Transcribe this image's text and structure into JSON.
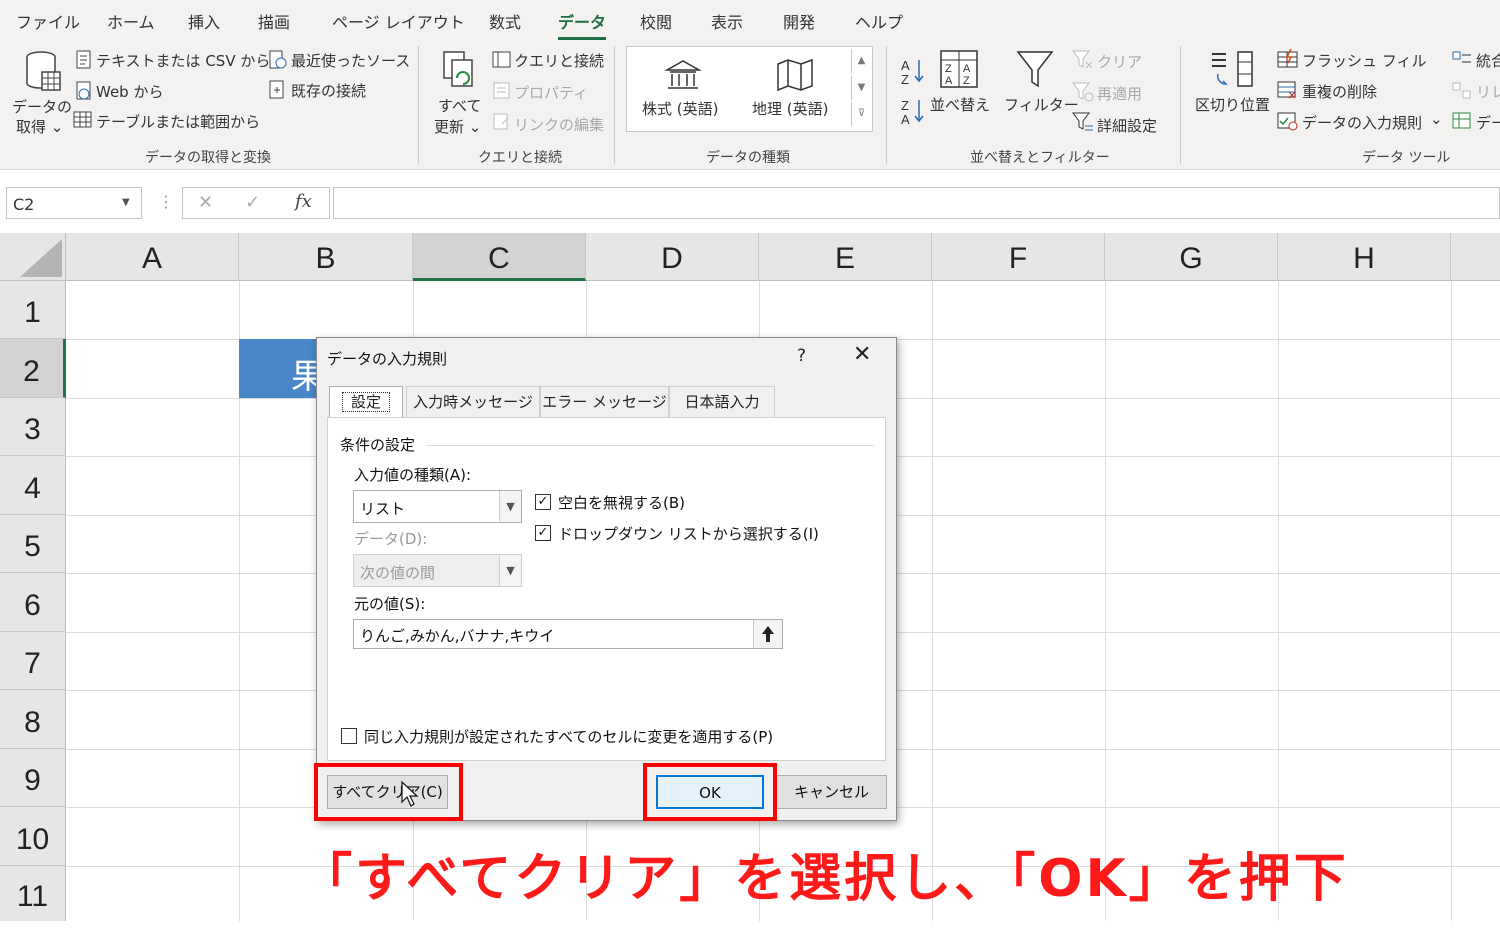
{
  "menu": {
    "tabs": [
      "ファイル",
      "ホーム",
      "挿入",
      "描画",
      "ページ レイアウト",
      "数式",
      "データ",
      "校閲",
      "表示",
      "開発",
      "ヘルプ"
    ],
    "active_index": 6
  },
  "ribbon": {
    "get_data": {
      "big_label_1": "データの",
      "big_label_2": "取得 ⌄",
      "items": [
        "テキストまたは CSV から",
        "Web から",
        "テーブルまたは範囲から"
      ],
      "items2": [
        "最近使ったソース",
        "既存の接続"
      ],
      "group_label": "データの取得と変換"
    },
    "queries": {
      "refresh_1": "すべて",
      "refresh_2": "更新 ⌄",
      "items": [
        "クエリと接続",
        "プロパティ",
        "リンクの編集"
      ],
      "group_label": "クエリと接続"
    },
    "data_types": {
      "stocks": "株式 (英語)",
      "geography": "地理 (英語)",
      "group_label": "データの種類"
    },
    "sort_filter": {
      "sort": "並べ替え",
      "filter": "フィルター",
      "items": [
        "クリア",
        "再適用",
        "詳細設定"
      ],
      "group_label": "並べ替えとフィルター"
    },
    "data_tools": {
      "split": "区切り位置",
      "items": [
        "フラッシュ フィル",
        "重複の削除",
        "データの入力規則"
      ],
      "more": [
        "統合",
        "リレ",
        "デー"
      ],
      "group_label": "データ ツール"
    }
  },
  "formula_bar": {
    "name_box": "C2",
    "cancel": "✕",
    "enter": "✓",
    "fx": "fx",
    "formula": ""
  },
  "sheet": {
    "columns": [
      "A",
      "B",
      "C",
      "D",
      "E",
      "F",
      "G",
      "H"
    ],
    "rows": [
      "1",
      "2",
      "3",
      "4",
      "5",
      "6",
      "7",
      "8",
      "9",
      "10",
      "11"
    ],
    "selected_col": "C",
    "selected_row": "2",
    "b2_text": "果"
  },
  "dialog": {
    "title": "データの入力規則",
    "help": "?",
    "close": "✕",
    "tabs": [
      "設定",
      "入力時メッセージ",
      "エラー メッセージ",
      "日本語入力"
    ],
    "active_tab": 0,
    "section": "条件の設定",
    "allow_label": "入力値の種類(A):",
    "allow_value": "リスト",
    "data_label": "データ(D):",
    "data_value": "次の値の間",
    "ignore_blank": "空白を無視する(B)",
    "dropdown": "ドロップダウン リストから選択する(I)",
    "source_label": "元の値(S):",
    "source_value": "りんご,みかん,バナナ,キウイ",
    "apply_all": "同じ入力規則が設定されたすべてのセルに変更を適用する(P)",
    "clear_all": "すべてクリア(C)",
    "ok": "OK",
    "cancel": "キャンセル",
    "checked_mark": "✓"
  },
  "annotation": "「すべてクリア」を選択し、「OK」を押下",
  "colors": {
    "accent": "#217346",
    "highlight_red": "#ff0000",
    "cell_fill": "#4a86c8"
  },
  "icons": [
    "database-icon",
    "text-file-icon",
    "web-icon",
    "table-icon",
    "recent-sources-icon",
    "existing-connections-icon",
    "refresh-icon",
    "bank-icon",
    "map-icon",
    "sort-az-icon",
    "sort-dialog-icon",
    "filter-icon",
    "text-to-columns-icon",
    "upload-arrow-icon",
    "cursor-icon"
  ]
}
